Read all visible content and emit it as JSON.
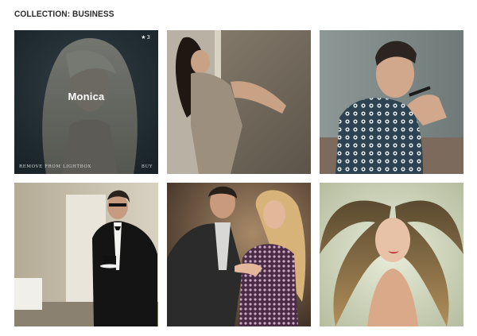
{
  "collection": {
    "title": "COLLECTION: BUSINESS"
  },
  "tiles": [
    {
      "subject": "Monica",
      "hovered": true,
      "star_icon": "star-icon",
      "star_count": "3",
      "remove_label": "REMOVE FROM LIGHTBOX",
      "buy_label": "BUY"
    },
    {
      "subject": "",
      "hovered": false
    },
    {
      "subject": "",
      "hovered": false
    },
    {
      "subject": "",
      "hovered": false
    },
    {
      "subject": "",
      "hovered": false
    },
    {
      "subject": "",
      "hovered": false
    }
  ],
  "colors": {
    "overlay": "#121c20",
    "title_text": "#2b2b2b",
    "overlay_text": "#ffffff"
  }
}
